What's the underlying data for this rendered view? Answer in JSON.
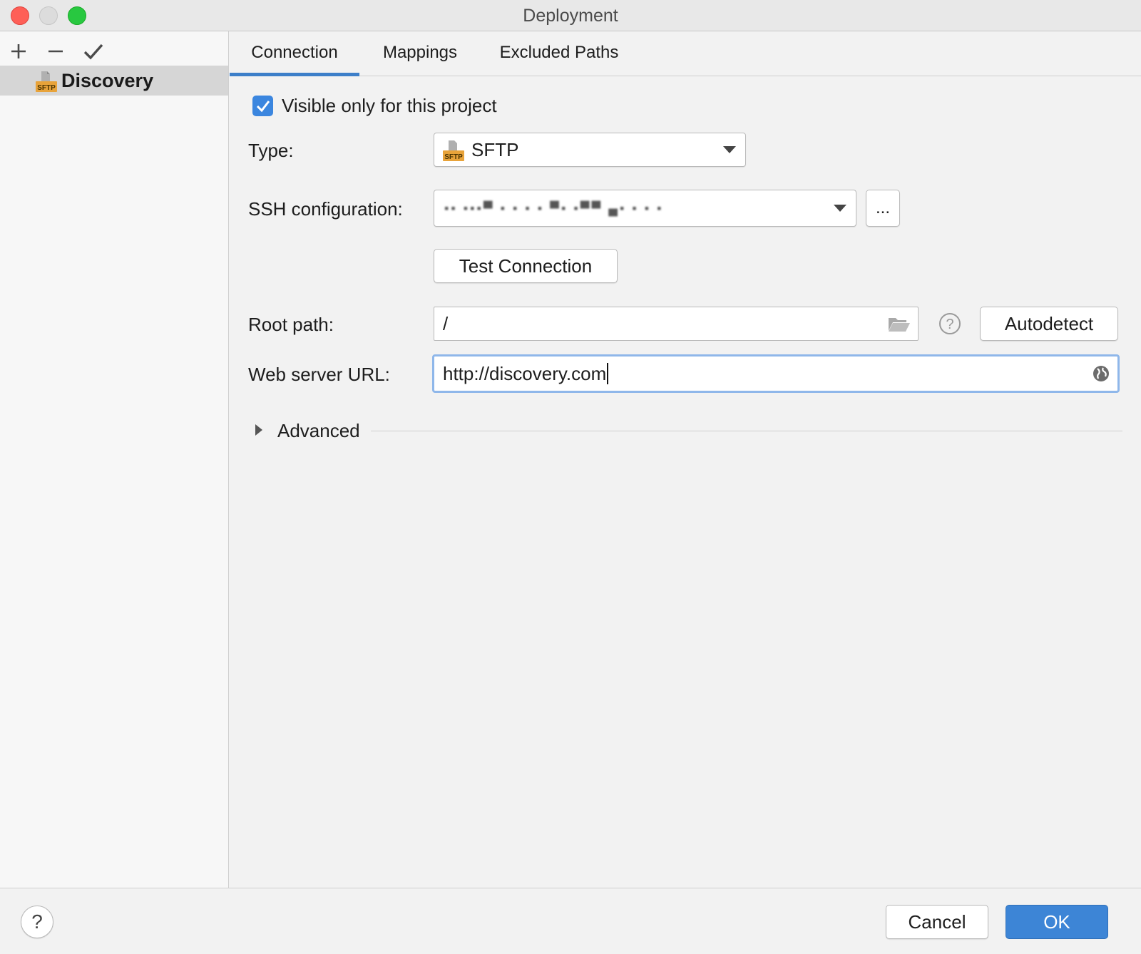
{
  "window": {
    "title": "Deployment"
  },
  "sidebar": {
    "toolbar": {
      "add_icon": "plus-icon",
      "remove_icon": "minus-icon",
      "apply_icon": "checkmark-icon"
    },
    "items": [
      {
        "label": "Discovery",
        "icon": "sftp-icon",
        "selected": true
      }
    ]
  },
  "tabs": [
    {
      "label": "Connection",
      "active": true
    },
    {
      "label": "Mappings",
      "active": false
    },
    {
      "label": "Excluded Paths",
      "active": false
    }
  ],
  "form": {
    "visible_only": {
      "label": "Visible only for this project",
      "checked": true
    },
    "type": {
      "label": "Type:",
      "value": "SFTP"
    },
    "ssh": {
      "label": "SSH configuration:",
      "value": "▪▪ ▪▪▪▀ ▪ ▪ ▪ ▪ ▀▪ ▪▀▀ ▄▪ ▪ ▪ ▪",
      "more_label": "..."
    },
    "test_connection": {
      "label": "Test Connection"
    },
    "root_path": {
      "label": "Root path:",
      "value": "/"
    },
    "autodetect": {
      "label": "Autodetect"
    },
    "web_url": {
      "label": "Web server URL:",
      "value": "http://discovery.com"
    },
    "advanced": {
      "label": "Advanced",
      "expanded": false
    }
  },
  "footer": {
    "help_label": "?",
    "cancel_label": "Cancel",
    "ok_label": "OK"
  },
  "colors": {
    "accent": "#3d85d6",
    "tab_indicator": "#3d7fc9",
    "close": "#fe5f57",
    "maximize": "#28c840",
    "sftp_badge": "#e8a33a"
  }
}
